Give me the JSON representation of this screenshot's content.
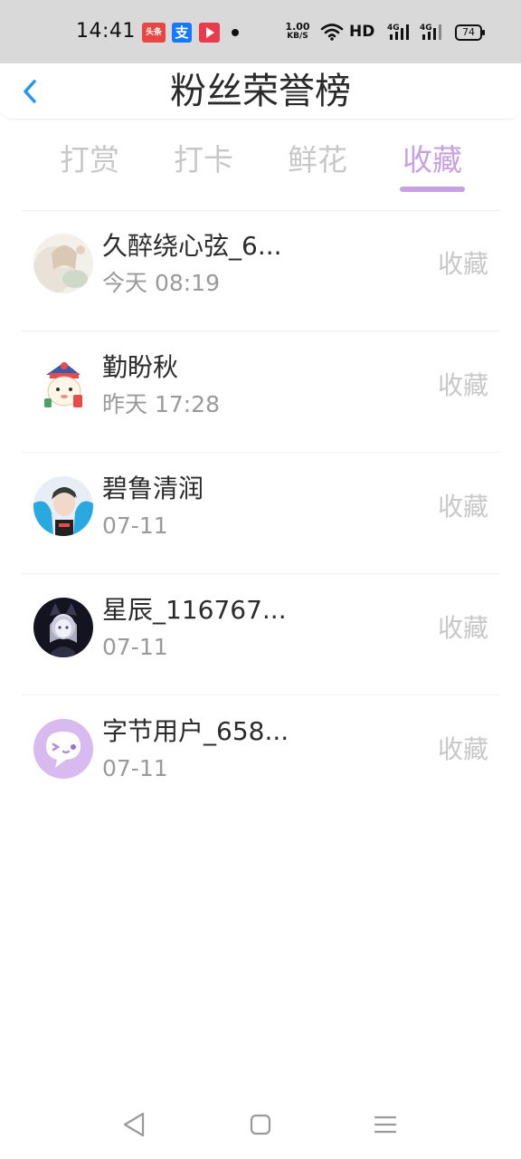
{
  "status_bar": {
    "time": "14:41",
    "notif_1": "头条",
    "notif_2": "支",
    "net_speed_top": "1.00",
    "net_speed_bottom": "KB/S",
    "hd_label": "HD",
    "sig_label_1": "4G",
    "sig_label_2": "4G",
    "battery": "74"
  },
  "header": {
    "title": "粉丝荣誉榜",
    "back_icon": "chevron-left-icon",
    "accent_color": "#2196f3"
  },
  "tabs": {
    "items": [
      {
        "label": "打赏"
      },
      {
        "label": "打卡"
      },
      {
        "label": "鲜花"
      },
      {
        "label": "收藏"
      }
    ],
    "active_index": 3,
    "active_color": "#c9a1e0",
    "inactive_color": "#c8c8c8"
  },
  "list": {
    "items": [
      {
        "name": "久醉绕心弦_6...",
        "time": "今天 08:19",
        "action": "收藏",
        "avatar": "anime-girl-avatar"
      },
      {
        "name": "勤盼秋",
        "time": "昨天 17:28",
        "action": "收藏",
        "avatar": "cartoon-character-avatar"
      },
      {
        "name": "碧鲁清润",
        "time": "07-11",
        "action": "收藏",
        "avatar": "person-photo-avatar"
      },
      {
        "name": "星辰_116767...",
        "time": "07-11",
        "action": "收藏",
        "avatar": "dark-anime-avatar"
      },
      {
        "name": "字节用户_658...",
        "time": "07-11",
        "action": "收藏",
        "avatar": "default-purple-avatar"
      }
    ]
  },
  "navbar": {
    "back": "triangle-back-icon",
    "home": "square-home-icon",
    "menu": "hamburger-menu-icon"
  }
}
